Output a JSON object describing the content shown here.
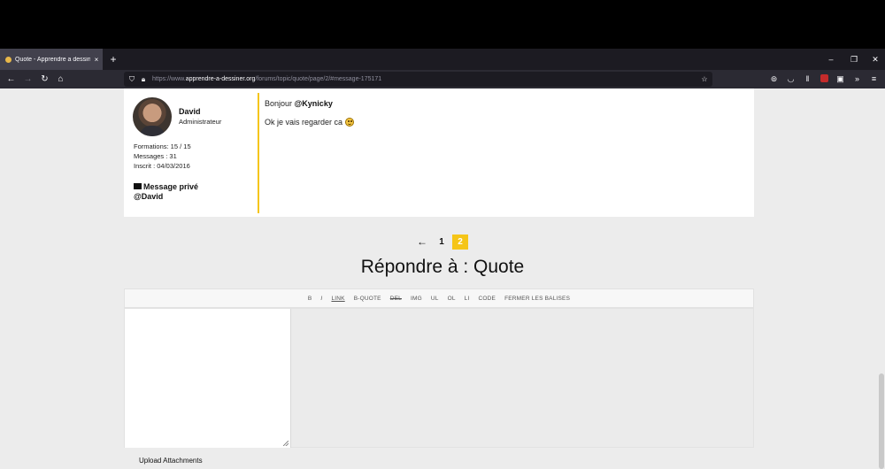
{
  "browser": {
    "tab_title": "Quote - Apprendre a dessiner",
    "tab_close": "×",
    "new_tab": "+",
    "url_prefix": "https://www.",
    "url_domain": "apprendre-a-dessiner.org",
    "url_path": "/forums/topic/quote/page/2/#message-175171"
  },
  "post": {
    "author_name": "David",
    "author_role": "Administrateur",
    "formations": "Formations: 15 / 15",
    "messages": "Messages : 31",
    "inscrit": "Inscrit : 04/03/2016",
    "pm_label": "Message privé",
    "pm_handle": "@David",
    "greeting": "Bonjour ",
    "mention": "@Kynicky",
    "message": "Ok je vais regarder ca"
  },
  "pagination": {
    "prev": "←",
    "pages": [
      "1",
      "2"
    ],
    "current": "2"
  },
  "reply": {
    "title": "Répondre à : Quote",
    "toolbar": [
      "B",
      "I",
      "LINK",
      "B-QUOTE",
      "DEL",
      "IMG",
      "UL",
      "OL",
      "LI",
      "CODE",
      "FERMER LES BALISES"
    ],
    "upload_label": "Upload Attachments"
  },
  "colors": {
    "accent": "#f5c518",
    "page_bg": "#ececec"
  }
}
